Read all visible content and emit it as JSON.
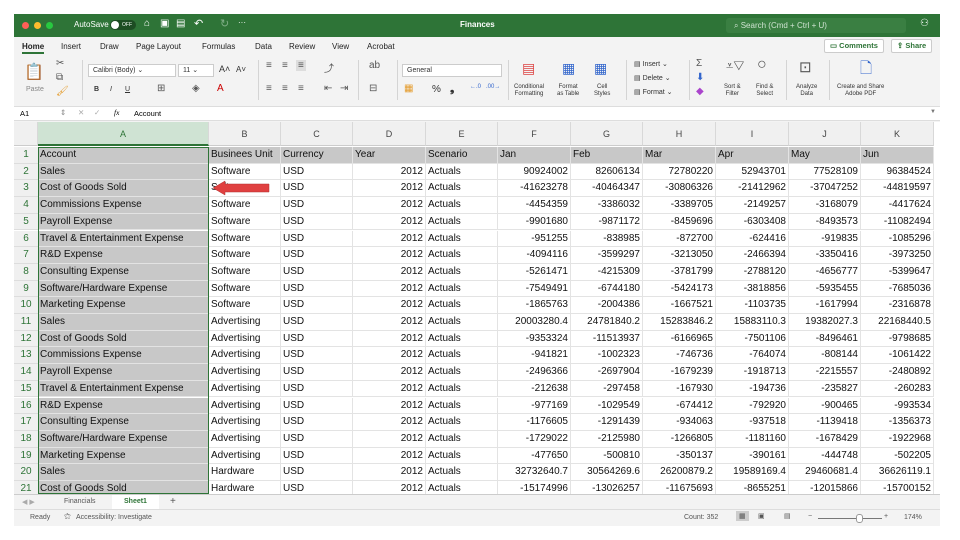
{
  "titlebar": {
    "autosave": "AutoSave",
    "toggle": "OFF",
    "title": "Finances",
    "search_placeholder": "Search (Cmd + Ctrl + U)"
  },
  "menu": [
    "Home",
    "Insert",
    "Draw",
    "Page Layout",
    "Formulas",
    "Data",
    "Review",
    "View",
    "Acrobat"
  ],
  "top_buttons": {
    "comments": "Comments",
    "share": "Share"
  },
  "ribbon": {
    "paste": "Paste",
    "font": "Calibri (Body)",
    "size": "11",
    "number_format": "General",
    "bold": "B",
    "italic": "I",
    "underline": "U",
    "percent": "%",
    "comma": "❟",
    "conditional": [
      "Conditional",
      "Formatting"
    ],
    "format_table": [
      "Format",
      "as Table"
    ],
    "cell_styles": [
      "Cell",
      "Styles"
    ],
    "insert": "Insert",
    "delete": "Delete",
    "format": "Format",
    "sort": [
      "Sort &",
      "Filter"
    ],
    "find": [
      "Find &",
      "Select"
    ],
    "analyze": [
      "Analyze",
      "Data"
    ],
    "adobe": [
      "Create and Share",
      "Adobe PDF"
    ]
  },
  "formula_bar": {
    "name_box": "A1",
    "fx": "fx",
    "value": "Account"
  },
  "columns": [
    "A",
    "B",
    "C",
    "D",
    "E",
    "F",
    "G",
    "H",
    "I",
    "J",
    "K"
  ],
  "rows": [
    [
      "Account",
      "Businees Unit",
      "Currency",
      "Year",
      "Scenario",
      "Jan",
      "Feb",
      "Mar",
      "Apr",
      "May",
      "Jun"
    ],
    [
      "Sales",
      "Software",
      "USD",
      "2012",
      "Actuals",
      "90924002",
      "82606134",
      "72780220",
      "52943701",
      "77528109",
      "96384524"
    ],
    [
      "Cost of Goods Sold",
      "Software",
      "USD",
      "2012",
      "Actuals",
      "-41623278",
      "-40464347",
      "-30806326",
      "-21412962",
      "-37047252",
      "-44819597"
    ],
    [
      "Commissions Expense",
      "Software",
      "USD",
      "2012",
      "Actuals",
      "-4454359",
      "-3386032",
      "-3389705",
      "-2149257",
      "-3168079",
      "-4417624"
    ],
    [
      "Payroll Expense",
      "Software",
      "USD",
      "2012",
      "Actuals",
      "-9901680",
      "-9871172",
      "-8459696",
      "-6303408",
      "-8493573",
      "-11082494"
    ],
    [
      "Travel & Entertainment Expense",
      "Software",
      "USD",
      "2012",
      "Actuals",
      "-951255",
      "-838985",
      "-872700",
      "-624416",
      "-919835",
      "-1085296"
    ],
    [
      "R&D Expense",
      "Software",
      "USD",
      "2012",
      "Actuals",
      "-4094116",
      "-3599297",
      "-3213050",
      "-2466394",
      "-3350416",
      "-3973250"
    ],
    [
      "Consulting Expense",
      "Software",
      "USD",
      "2012",
      "Actuals",
      "-5261471",
      "-4215309",
      "-3781799",
      "-2788120",
      "-4656777",
      "-5399647"
    ],
    [
      "Software/Hardware Expense",
      "Software",
      "USD",
      "2012",
      "Actuals",
      "-7549491",
      "-6744180",
      "-5424173",
      "-3818856",
      "-5935455",
      "-7685036"
    ],
    [
      "Marketing Expense",
      "Software",
      "USD",
      "2012",
      "Actuals",
      "-1865763",
      "-2004386",
      "-1667521",
      "-1103735",
      "-1617994",
      "-2316878"
    ],
    [
      "Sales",
      "Advertising",
      "USD",
      "2012",
      "Actuals",
      "20003280.4",
      "24781840.2",
      "15283846.2",
      "15883110.3",
      "19382027.3",
      "22168440.5"
    ],
    [
      "Cost of Goods Sold",
      "Advertising",
      "USD",
      "2012",
      "Actuals",
      "-9353324",
      "-11513937",
      "-6166965",
      "-7501106",
      "-8496461",
      "-9798685"
    ],
    [
      "Commissions Expense",
      "Advertising",
      "USD",
      "2012",
      "Actuals",
      "-941821",
      "-1002323",
      "-746736",
      "-764074",
      "-808144",
      "-1061422"
    ],
    [
      "Payroll Expense",
      "Advertising",
      "USD",
      "2012",
      "Actuals",
      "-2496366",
      "-2697904",
      "-1679239",
      "-1918713",
      "-2215557",
      "-2480892"
    ],
    [
      "Travel & Entertainment Expense",
      "Advertising",
      "USD",
      "2012",
      "Actuals",
      "-212638",
      "-297458",
      "-167930",
      "-194736",
      "-235827",
      "-260283"
    ],
    [
      "R&D Expense",
      "Advertising",
      "USD",
      "2012",
      "Actuals",
      "-977169",
      "-1029549",
      "-674412",
      "-792920",
      "-900465",
      "-993534"
    ],
    [
      "Consulting Expense",
      "Advertising",
      "USD",
      "2012",
      "Actuals",
      "-1176605",
      "-1291439",
      "-934063",
      "-937518",
      "-1139418",
      "-1356373"
    ],
    [
      "Software/Hardware Expense",
      "Advertising",
      "USD",
      "2012",
      "Actuals",
      "-1729022",
      "-2125980",
      "-1266805",
      "-1181160",
      "-1678429",
      "-1922968"
    ],
    [
      "Marketing Expense",
      "Advertising",
      "USD",
      "2012",
      "Actuals",
      "-477650",
      "-500810",
      "-350137",
      "-390161",
      "-444748",
      "-502205"
    ],
    [
      "Sales",
      "Hardware",
      "USD",
      "2012",
      "Actuals",
      "32732640.7",
      "30564269.6",
      "26200879.2",
      "19589169.4",
      "29460681.4",
      "36626119.1"
    ],
    [
      "Cost of Goods Sold",
      "Hardware",
      "USD",
      "2012",
      "Actuals",
      "-15174996",
      "-13026257",
      "-11675693",
      "-8655251",
      "-12015866",
      "-15700152"
    ]
  ],
  "sheets": [
    "Financials",
    "Sheet1"
  ],
  "active_sheet": "Sheet1",
  "status": {
    "ready": "Ready",
    "accessibility": "Accessibility: Investigate",
    "count": "Count: 352",
    "zoom": "174%"
  },
  "colors": {
    "accent": "#2e7437",
    "arrow": "#e04040"
  }
}
